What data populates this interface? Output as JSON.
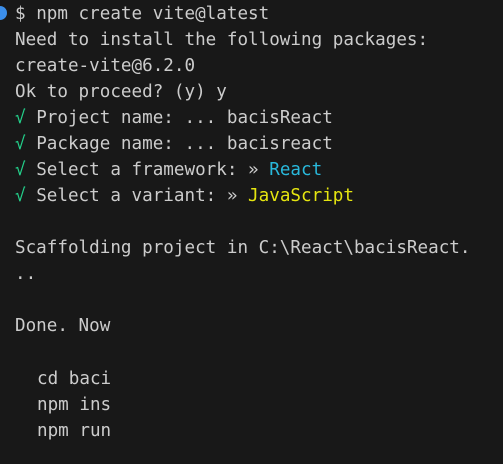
{
  "prompt": {
    "symbol": "$",
    "command": "npm create vite@latest"
  },
  "output": {
    "need_install": "Need to install the following packages:",
    "package": "create-vite@6.2.0",
    "proceed": "Ok to proceed? (y) y"
  },
  "answers": [
    {
      "check": "√",
      "label": "Project name:",
      "sep": "...",
      "value": "bacisReact"
    },
    {
      "check": "√",
      "label": "Package name:",
      "sep": "...",
      "value": "bacisreact"
    },
    {
      "check": "√",
      "label": "Select a framework:",
      "sep": "»",
      "value": "React"
    },
    {
      "check": "√",
      "label": "Select a variant:",
      "sep": "»",
      "value": "JavaScript"
    }
  ],
  "scaffolding": {
    "line1": "Scaffolding project in C:\\React\\bacisReact.",
    "line2": ".."
  },
  "done": "Done. Now",
  "commands": [
    "cd baci",
    "npm ins",
    "npm run"
  ],
  "colors": {
    "background": "#181818",
    "text": "#cccccc",
    "check": "#23d18b",
    "framework": "#29b8db",
    "variant": "#e5e510",
    "prompt_marker": "#3b8eea"
  }
}
